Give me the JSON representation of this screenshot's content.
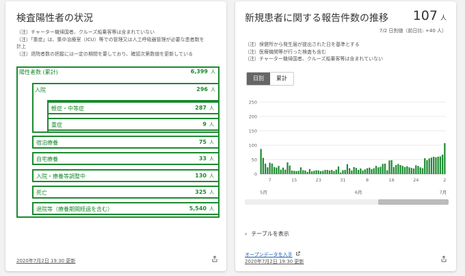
{
  "left": {
    "title": "検査陽性者の状況",
    "notes": [
      "（注）チャーター機帰国者、クルーズ船乗客等は含まれていない",
      "（注）「重症」は、集中治療室（ICU）等での管理又は人工呼吸器管理が必要な患者数を",
      "計上",
      "（注）退院者数の把握には一定の期間を要しており、確認次第数値を更新している"
    ],
    "rows": [
      {
        "label": "陽性者数 (累計)",
        "value": "6,399",
        "unit": "人"
      },
      {
        "label": "入院",
        "value": "296",
        "unit": "人"
      },
      {
        "label": "軽症・中等症",
        "value": "287",
        "unit": "人"
      },
      {
        "label": "重症",
        "value": "9",
        "unit": "人"
      },
      {
        "label": "宿泊療養",
        "value": "75",
        "unit": "人"
      },
      {
        "label": "自宅療養",
        "value": "33",
        "unit": "人"
      },
      {
        "label": "入院・療養等調整中",
        "value": "130",
        "unit": "人"
      },
      {
        "label": "死亡",
        "value": "325",
        "unit": "人"
      },
      {
        "label": "退院等（療養期間経過を含む）",
        "value": "5,540",
        "unit": "人"
      }
    ],
    "updated": "2020年7月2日 19:30 更新"
  },
  "right": {
    "title": "新規患者に関する報告件数の推移",
    "count": "107",
    "count_unit": "人",
    "sub": "7/2 日別値（前日比: +40 人）",
    "notes": [
      "（注）保健所から発生届が提出された日を基準とする",
      "（注）医療機関等が行った検査も含む",
      "（注）チャーター機帰国者、クルーズ船乗客等は含まれていない"
    ],
    "tabs": [
      "日別",
      "累計"
    ],
    "toggle_label": "テーブルを表示",
    "open_data": "オープンデータを入手",
    "updated": "2020年7月2日 19:30 更新"
  },
  "colors": {
    "accent": "#1a8a2e",
    "bar": "#1a8a2e",
    "link": "#1a5fb4"
  },
  "icons": [
    "share-icon",
    "external-link-icon",
    "chevron-right-icon"
  ],
  "chart_data": {
    "type": "bar",
    "ylim": [
      0,
      250
    ],
    "yticks": [
      "0",
      "50",
      "100",
      "150",
      "200",
      "250"
    ],
    "xticks": [
      "7",
      "15",
      "23",
      "31",
      "8",
      "16",
      "24",
      "2"
    ],
    "months": [
      "5月",
      "6月",
      "7月"
    ],
    "values": [
      87,
      56,
      36,
      23,
      39,
      36,
      24,
      22,
      28,
      15,
      22,
      15,
      40,
      29,
      12,
      11,
      10,
      11,
      23,
      13,
      12,
      7,
      17,
      9,
      11,
      13,
      12,
      10,
      11,
      14,
      14,
      12,
      14,
      10,
      15,
      26,
      5,
      13,
      14,
      34,
      20,
      12,
      24,
      21,
      14,
      19,
      12,
      16,
      20,
      22,
      17,
      20,
      28,
      23,
      25,
      35,
      36,
      13,
      47,
      48,
      24,
      31,
      35,
      31,
      28,
      24,
      27,
      23,
      21,
      19,
      30,
      28,
      23,
      20,
      55,
      48,
      54,
      57,
      60,
      58,
      60,
      61,
      67,
      107
    ]
  }
}
